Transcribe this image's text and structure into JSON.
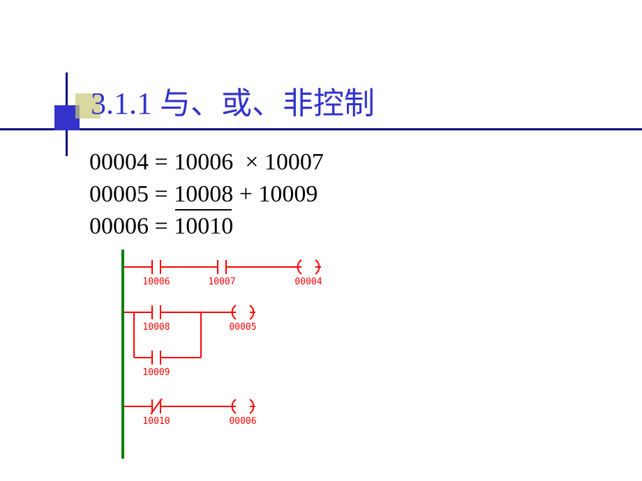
{
  "title": "3.1.1   与、或、非控制",
  "equations": {
    "line1": {
      "lhs": "00004",
      "op": "=",
      "a": "10006",
      "sym": "×",
      "b": "10007"
    },
    "line2": {
      "lhs": "00005",
      "op": "=",
      "a": "10008",
      "sym": "+",
      "b": "10009"
    },
    "line3": {
      "lhs": "00006",
      "op": "=",
      "a_over": "10010"
    }
  },
  "diagram": {
    "rung1": {
      "c1": "10006",
      "c2": "10007",
      "out": "00004",
      "c1_type": "no",
      "c2_type": "no"
    },
    "rung2": {
      "c1": "10008",
      "c2_parallel": "10009",
      "out": "00005",
      "c1_type": "no",
      "c2_type": "no"
    },
    "rung3": {
      "c1": "10010",
      "out": "00006",
      "c1_type": "nc"
    }
  },
  "colors": {
    "rail": "#008000",
    "wire": "#ff0000",
    "text": "#ff0000"
  }
}
